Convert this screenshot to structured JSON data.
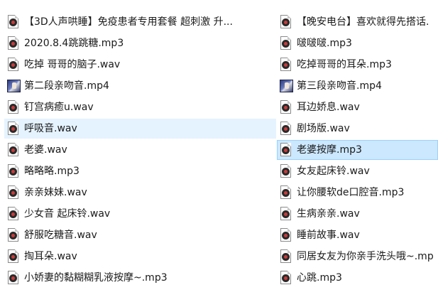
{
  "files": {
    "left": [
      {
        "name": "【3D人声哄睡】免疫患者专用套餐 超刺激 升...",
        "type": "audio"
      },
      {
        "name": "2020.8.4跳跳糖.mp3",
        "type": "audio"
      },
      {
        "name": "吃掉 哥哥的脑子.wav",
        "type": "audio"
      },
      {
        "name": "第二段亲吻音.mp4",
        "type": "video"
      },
      {
        "name": "钉宫病癒u.wav",
        "type": "audio"
      },
      {
        "name": "呼吸音.wav",
        "type": "audio"
      },
      {
        "name": "老婆.wav",
        "type": "audio"
      },
      {
        "name": "略略略.mp3",
        "type": "audio"
      },
      {
        "name": "亲亲妹妹.wav",
        "type": "audio"
      },
      {
        "name": "少女音 起床铃.wav",
        "type": "audio"
      },
      {
        "name": "舒服吃糖音.wav",
        "type": "audio"
      },
      {
        "name": "掏耳朵.wav",
        "type": "audio"
      },
      {
        "name": "小娇妻的黏糊糊乳液按摩~.mp3",
        "type": "audio"
      }
    ],
    "right": [
      {
        "name": "【晚安电台】喜欢就得先搭话.",
        "type": "audio"
      },
      {
        "name": "啵啵啵.mp3",
        "type": "audio"
      },
      {
        "name": "吃掉哥哥的耳朵.mp3",
        "type": "audio"
      },
      {
        "name": "第三段亲吻音.mp4",
        "type": "video"
      },
      {
        "name": "耳边娇息.wav",
        "type": "audio"
      },
      {
        "name": "剧场版.wav",
        "type": "audio"
      },
      {
        "name": "老婆按摩.mp3",
        "type": "audio"
      },
      {
        "name": "女友起床铃.wav",
        "type": "audio"
      },
      {
        "name": "让你腰软de口腔音.mp3",
        "type": "audio"
      },
      {
        "name": "生病亲亲.wav",
        "type": "audio"
      },
      {
        "name": "睡前故事.wav",
        "type": "audio"
      },
      {
        "name": "同居女友为你亲手洗头哦~.mp",
        "type": "audio"
      },
      {
        "name": "心跳.mp3",
        "type": "audio"
      }
    ]
  },
  "state": {
    "hovered": "呼吸音.wav",
    "selected": "老婆按摩.mp3"
  },
  "colors": {
    "hover": "#e5f3ff",
    "selected": "#cce8ff",
    "selected_border": "#99d1ff"
  }
}
